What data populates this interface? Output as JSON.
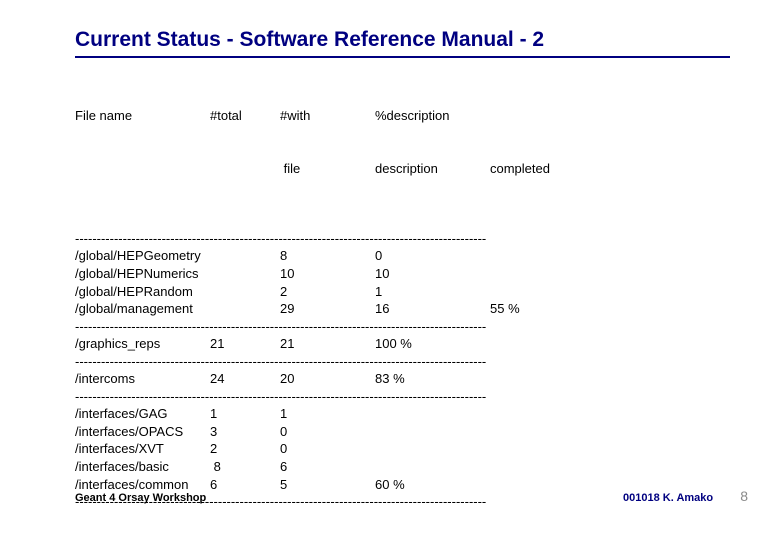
{
  "title": "Current Status - Software Reference Manual - 2",
  "headers": {
    "c0": "File name",
    "c1": "#total",
    "c2_a": "#with",
    "c2_b": " file",
    "c3_a": "%description",
    "c3_b": "description",
    "c4": "completed"
  },
  "sep": "-----------------------------------------------------------------------------------------------",
  "sections": [
    {
      "rows": [
        {
          "c0": "/global/HEPGeometry",
          "c1": "",
          "c2": "8",
          "c3": "0",
          "c4": ""
        },
        {
          "c0": "/global/HEPNumerics",
          "c1": "",
          "c2": "10",
          "c3": "10",
          "c4": ""
        },
        {
          "c0": "/global/HEPRandom",
          "c1": "",
          "c2": "2",
          "c3": "1",
          "c4": ""
        },
        {
          "c0": "/global/management",
          "c1": "",
          "c2": "29",
          "c3": "16",
          "c4": "55 %"
        }
      ]
    },
    {
      "rows": [
        {
          "c0": "/graphics_reps",
          "c1": "21",
          "c2": "21",
          "c3": "100 %",
          "c4": ""
        }
      ]
    },
    {
      "rows": [
        {
          "c0": "/intercoms",
          "c1": "24",
          "c2": "20",
          "c3": "83 %",
          "c4": ""
        }
      ]
    },
    {
      "rows": [
        {
          "c0": "/interfaces/GAG",
          "c1": "1",
          "c2": "1",
          "c3": "",
          "c4": ""
        },
        {
          "c0": "/interfaces/OPACS",
          "c1": "3",
          "c2": "0",
          "c3": "",
          "c4": ""
        },
        {
          "c0": "/interfaces/XVT",
          "c1": "2",
          "c2": "0",
          "c3": "",
          "c4": ""
        },
        {
          "c0": "/interfaces/basic",
          "c1": " 8",
          "c2": "6",
          "c3": "",
          "c4": ""
        },
        {
          "c0": "/interfaces/common",
          "c1": "6",
          "c2": "5",
          "c3": "60 %",
          "c4": ""
        }
      ]
    }
  ],
  "footer": {
    "left": "Geant 4 Orsay Workshop",
    "right": "001018  K. Amako",
    "page": "8"
  }
}
